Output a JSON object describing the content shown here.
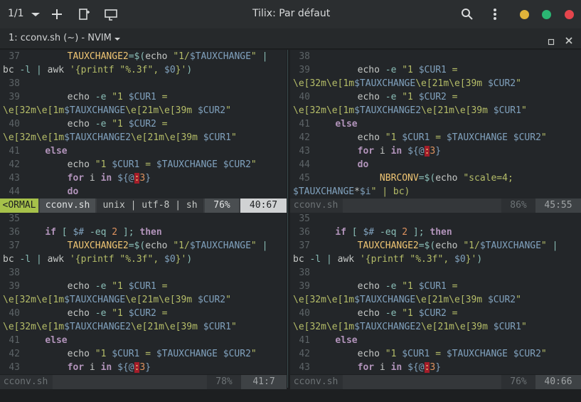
{
  "titlebar": {
    "session_counter": "1/1",
    "window_title": "Tilix: Par défaut",
    "colors": {
      "min": "#e0b33a",
      "max": "#2bb673",
      "close": "#e5454c"
    }
  },
  "tab": {
    "title": "1: cconv.sh (~) - NVIM"
  },
  "panes": {
    "top_left": {
      "lines": [
        {
          "n": "37",
          "t": "        TAUXCHANGE2=$(echo \"1/$TAUXCHANGE\" |"
        },
        {
          "n": "",
          "t": "bc -l | awk '{printf \"%.3f\", $0}')"
        },
        {
          "n": "38",
          "t": ""
        },
        {
          "n": "39",
          "t": "        echo -e \"1 $CUR1 ="
        },
        {
          "n": "",
          "t": "\\e[32m\\e[1m$TAUXCHANGE\\e[21m\\e[39m $CUR2\""
        },
        {
          "n": "40",
          "t": "        echo -e \"1 $CUR2 ="
        },
        {
          "n": "",
          "t": "\\e[32m\\e[1m$TAUXCHANGE2\\e[21m\\e[39m $CUR1\""
        },
        {
          "n": "41",
          "t": "    else"
        },
        {
          "n": "42",
          "t": "        echo \"1 $CUR1 = $TAUXCHANGE $CUR2\""
        },
        {
          "n": "43",
          "t": "        for i in ${@:3}"
        },
        {
          "n": "44",
          "t": "        do"
        }
      ],
      "status": {
        "mode": "<ORMAL",
        "file": "cconv.sh",
        "fmt": "unix | utf-8 | sh",
        "pct": "76%",
        "pos": "40:67"
      }
    },
    "top_right": {
      "lines": [
        {
          "n": "38",
          "t": ""
        },
        {
          "n": "39",
          "t": "        echo -e \"1 $CUR1 ="
        },
        {
          "n": "",
          "t": "\\e[32m\\e[1m$TAUXCHANGE\\e[21m\\e[39m $CUR2\""
        },
        {
          "n": "40",
          "t": "        echo -e \"1 $CUR2 ="
        },
        {
          "n": "",
          "t": "\\e[32m\\e[1m$TAUXCHANGE2\\e[21m\\e[39m $CUR1\""
        },
        {
          "n": "41",
          "t": "    else"
        },
        {
          "n": "42",
          "t": "        echo \"1 $CUR1 = $TAUXCHANGE $CUR2\""
        },
        {
          "n": "43",
          "t": "        for i in ${@:3}"
        },
        {
          "n": "44",
          "t": "        do"
        },
        {
          "n": "45",
          "t": "            NBRCONV=$(echo \"scale=4;"
        },
        {
          "n": "",
          "t": "$TAUXCHANGE*$i\" | bc)"
        }
      ],
      "status": {
        "file": "cconv.sh",
        "pct": "86%",
        "pos": "45:55"
      }
    },
    "bottom_left": {
      "lines": [
        {
          "n": "35",
          "t": ""
        },
        {
          "n": "36",
          "t": "    if [ $# -eq 2 ]; then"
        },
        {
          "n": "37",
          "t": "        TAUXCHANGE2=$(echo \"1/$TAUXCHANGE\" |"
        },
        {
          "n": "",
          "t": "bc -l | awk '{printf \"%.3f\", $0}')"
        },
        {
          "n": "38",
          "t": ""
        },
        {
          "n": "39",
          "t": "        echo -e \"1 $CUR1 ="
        },
        {
          "n": "",
          "t": "\\e[32m\\e[1m$TAUXCHANGE\\e[21m\\e[39m $CUR2\""
        },
        {
          "n": "40",
          "t": "        echo -e \"1 $CUR2 ="
        },
        {
          "n": "",
          "t": "\\e[32m\\e[1m$TAUXCHANGE2\\e[21m\\e[39m $CUR1\""
        },
        {
          "n": "41",
          "t": "    else"
        },
        {
          "n": "42",
          "t": "        echo \"1 $CUR1 = $TAUXCHANGE $CUR2\""
        },
        {
          "n": "43",
          "t": "        for i in ${@:3}"
        }
      ],
      "status": {
        "file": "cconv.sh",
        "pct": "78%",
        "pos": "41:7"
      }
    },
    "bottom_right": {
      "lines": [
        {
          "n": "35",
          "t": ""
        },
        {
          "n": "36",
          "t": "    if [ $# -eq 2 ]; then"
        },
        {
          "n": "37",
          "t": "        TAUXCHANGE2=$(echo \"1/$TAUXCHANGE\" |"
        },
        {
          "n": "",
          "t": "bc -l | awk '{printf \"%.3f\", $0}')"
        },
        {
          "n": "38",
          "t": ""
        },
        {
          "n": "39",
          "t": "        echo -e \"1 $CUR1 ="
        },
        {
          "n": "",
          "t": "\\e[32m\\e[1m$TAUXCHANGE\\e[21m\\e[39m $CUR2\""
        },
        {
          "n": "40",
          "t": "        echo -e \"1 $CUR2 ="
        },
        {
          "n": "",
          "t": "\\e[32m\\e[1m$TAUXCHANGE2\\e[21m\\e[39m $CUR1\""
        },
        {
          "n": "41",
          "t": "    else"
        },
        {
          "n": "42",
          "t": "        echo \"1 $CUR1 = $TAUXCHANGE $CUR2\""
        },
        {
          "n": "43",
          "t": "        for i in ${@:3}"
        }
      ],
      "status": {
        "file": "cconv.sh",
        "pct": "76%",
        "pos": "40:66"
      }
    }
  }
}
